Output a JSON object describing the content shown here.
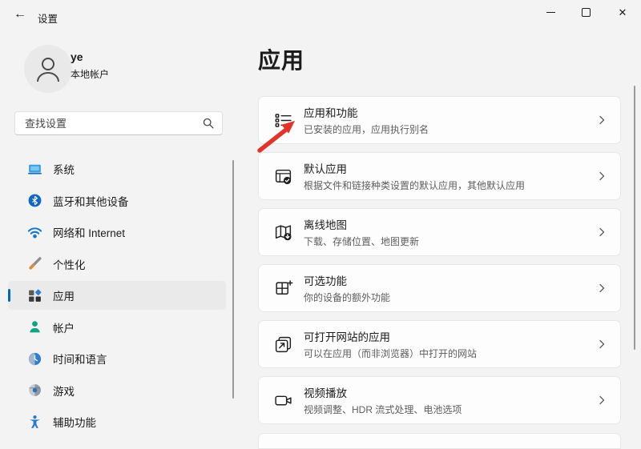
{
  "titlebar": {
    "title": "设置",
    "back_icon": "←",
    "close_glyph": "✕"
  },
  "user": {
    "name": "ye",
    "account_type": "本地帐户"
  },
  "search": {
    "placeholder": "查找设置"
  },
  "sidebar": {
    "items": [
      {
        "label": "系统",
        "icon": "system-icon",
        "selected": false
      },
      {
        "label": "蓝牙和其他设备",
        "icon": "bluetooth-icon",
        "selected": false
      },
      {
        "label": "网络和 Internet",
        "icon": "network-icon",
        "selected": false
      },
      {
        "label": "个性化",
        "icon": "personalization-icon",
        "selected": false
      },
      {
        "label": "应用",
        "icon": "apps-icon",
        "selected": true
      },
      {
        "label": "帐户",
        "icon": "accounts-icon",
        "selected": false
      },
      {
        "label": "时间和语言",
        "icon": "time-language-icon",
        "selected": false
      },
      {
        "label": "游戏",
        "icon": "gaming-icon",
        "selected": false
      },
      {
        "label": "辅助功能",
        "icon": "accessibility-icon",
        "selected": false
      }
    ]
  },
  "page": {
    "title": "应用"
  },
  "cards": [
    {
      "title": "应用和功能",
      "subtitle": "已安装的应用，应用执行别名",
      "icon": "apps-features-icon"
    },
    {
      "title": "默认应用",
      "subtitle": "根据文件和链接种类设置的默认应用，其他默认应用",
      "icon": "default-apps-icon"
    },
    {
      "title": "离线地图",
      "subtitle": "下载、存储位置、地图更新",
      "icon": "offline-maps-icon"
    },
    {
      "title": "可选功能",
      "subtitle": "你的设备的额外功能",
      "icon": "optional-features-icon"
    },
    {
      "title": "可打开网站的应用",
      "subtitle": "可以在应用（而非浏览器）中打开的网站",
      "icon": "apps-for-websites-icon"
    },
    {
      "title": "视频播放",
      "subtitle": "视频调整、HDR 流式处理、电池选项",
      "icon": "video-playback-icon"
    }
  ],
  "colors": {
    "accent": "#0067c0",
    "annotation_arrow": "#e3342b"
  }
}
